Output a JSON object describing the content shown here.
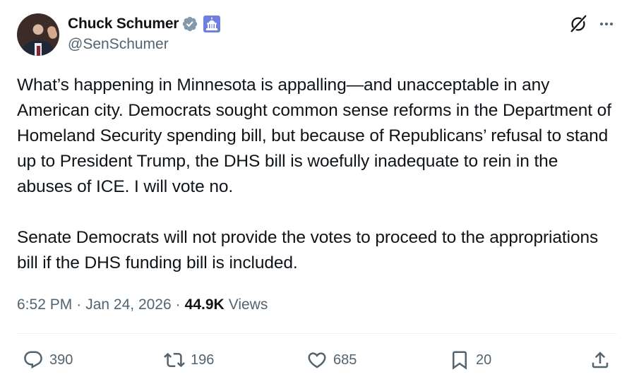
{
  "author": {
    "display_name": "Chuck Schumer",
    "handle": "@SenSchumer",
    "verified_badge": "verified-check-icon",
    "affiliation_badge": "us-capitol-icon"
  },
  "tweet": {
    "paragraphs": [
      "What’s happening in Minnesota is appalling—and unacceptable in any American city. Democrats sought common sense reforms in the Department of Homeland Security spending bill, but because of Republicans’ refusal to stand up to President Trump, the DHS bill is woefully inadequate to rein in the abuses of ICE. I will vote no.",
      "Senate Democrats will not provide the votes to proceed to the appropriations bill if the DHS funding bill is included."
    ]
  },
  "meta": {
    "time": "6:52 PM",
    "separator": "·",
    "date": "Jan 24, 2026",
    "views_count": "44.9K",
    "views_label": "Views"
  },
  "actions": {
    "replies": "390",
    "reposts": "196",
    "likes": "685",
    "bookmarks": "20"
  },
  "colors": {
    "text_primary": "#0f1419",
    "text_secondary": "#536471",
    "divider": "#eff3f4",
    "verified_badge": "#829aab"
  }
}
